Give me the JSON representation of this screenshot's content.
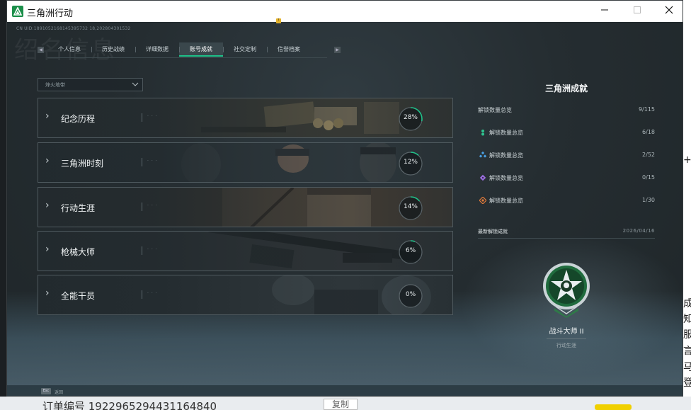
{
  "window": {
    "title": "三角洲行动",
    "minimize_icon": "minimize-icon",
    "maximize_icon": "maximize-icon",
    "close_icon": "close-icon"
  },
  "header": {
    "uid_line": "CN UID:1891052168145395732 18,202804301532",
    "ghost_title": "绍名信息"
  },
  "tabs": [
    {
      "label": "个人信息",
      "active": false
    },
    {
      "label": "历史战绩",
      "active": false
    },
    {
      "label": "详细数据",
      "active": false
    },
    {
      "label": "账号成就",
      "active": true
    },
    {
      "label": "社交定制",
      "active": false,
      "badge": "!"
    },
    {
      "label": "信誉档案",
      "active": false
    }
  ],
  "filter": {
    "value": "烽火地带"
  },
  "categories": [
    {
      "label": "纪念历程",
      "percent_text": "28%",
      "progress": 0.28
    },
    {
      "label": "三角洲时刻",
      "percent_text": "12%",
      "progress": 0.12
    },
    {
      "label": "行动生涯",
      "percent_text": "14%",
      "progress": 0.14
    },
    {
      "label": "枪械大师",
      "percent_text": "6%",
      "progress": 0.06
    },
    {
      "label": "全能干员",
      "percent_text": "0%",
      "progress": 0.0
    }
  ],
  "summary": {
    "title": "三角洲成就",
    "total": {
      "label": "解锁数量总览",
      "value": "9/115"
    },
    "rows": [
      {
        "label": "解锁数量总览",
        "value": "6/18",
        "color": "#2ec28e",
        "icon": "green-rank-icon"
      },
      {
        "label": "解锁数量总览",
        "value": "2/52",
        "color": "#4aa3e8",
        "icon": "blue-rank-icon"
      },
      {
        "label": "解锁数量总览",
        "value": "0/15",
        "color": "#9b6ee0",
        "icon": "purple-rank-icon"
      },
      {
        "label": "解锁数量总览",
        "value": "1/30",
        "color": "#e27b3a",
        "icon": "orange-rank-icon"
      }
    ],
    "latest_label": "最新解锁成就",
    "latest_date": "2026/04/16",
    "achievement_name": "战斗大师 II",
    "achievement_category": "行动生涯"
  },
  "footer": {
    "key": "Esc",
    "text": "返回"
  },
  "background_app": {
    "order_text": "订单编号   1922965294431164840",
    "copy_label": "复制",
    "side_text": [
      "成",
      "知",
      "服",
      "言",
      "马",
      "登"
    ],
    "side_text_top": "+方"
  }
}
